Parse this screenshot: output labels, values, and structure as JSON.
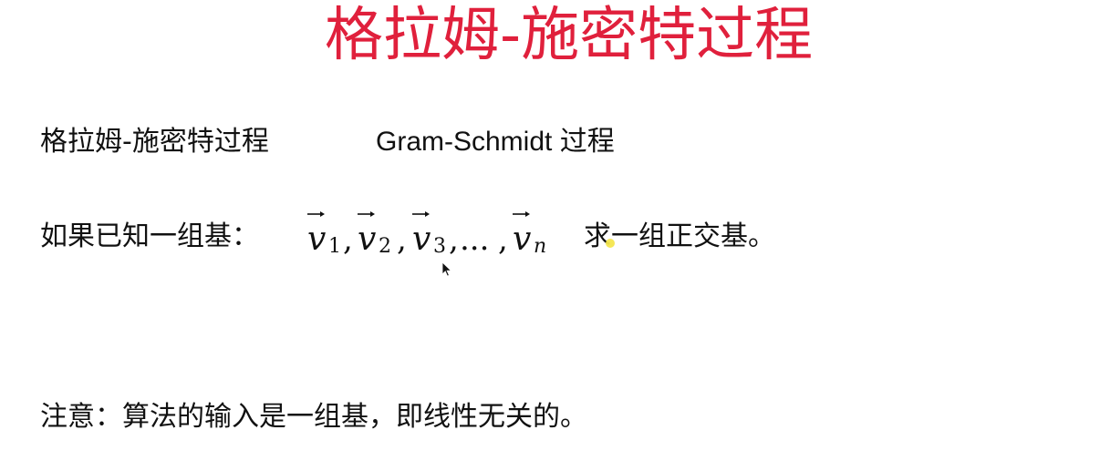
{
  "slide": {
    "title": "格拉姆-施密特过程",
    "line1": {
      "chinese_term": "格拉姆-施密特过程",
      "english_term": "Gram-Schmidt 过程"
    },
    "line2": {
      "prefix": "如果已知一组基：",
      "vectors": [
        {
          "symbol": "v",
          "subscript": "1"
        },
        {
          "symbol": "v",
          "subscript": "2"
        },
        {
          "symbol": "v",
          "subscript": "3"
        },
        {
          "symbol": "v",
          "subscript": "n"
        }
      ],
      "separator": ",",
      "ellipsis": "...",
      "suffix": "求一组正交基。"
    },
    "note": "注意：算法的输入是一组基，即线性无关的。"
  },
  "colors": {
    "title": "#e0203c",
    "body_text": "#111111",
    "highlight": "#f4e64e"
  },
  "icons": {
    "mouse_cursor": "arrow-cursor-icon",
    "pointer_highlight": "highlight-dot-icon"
  }
}
